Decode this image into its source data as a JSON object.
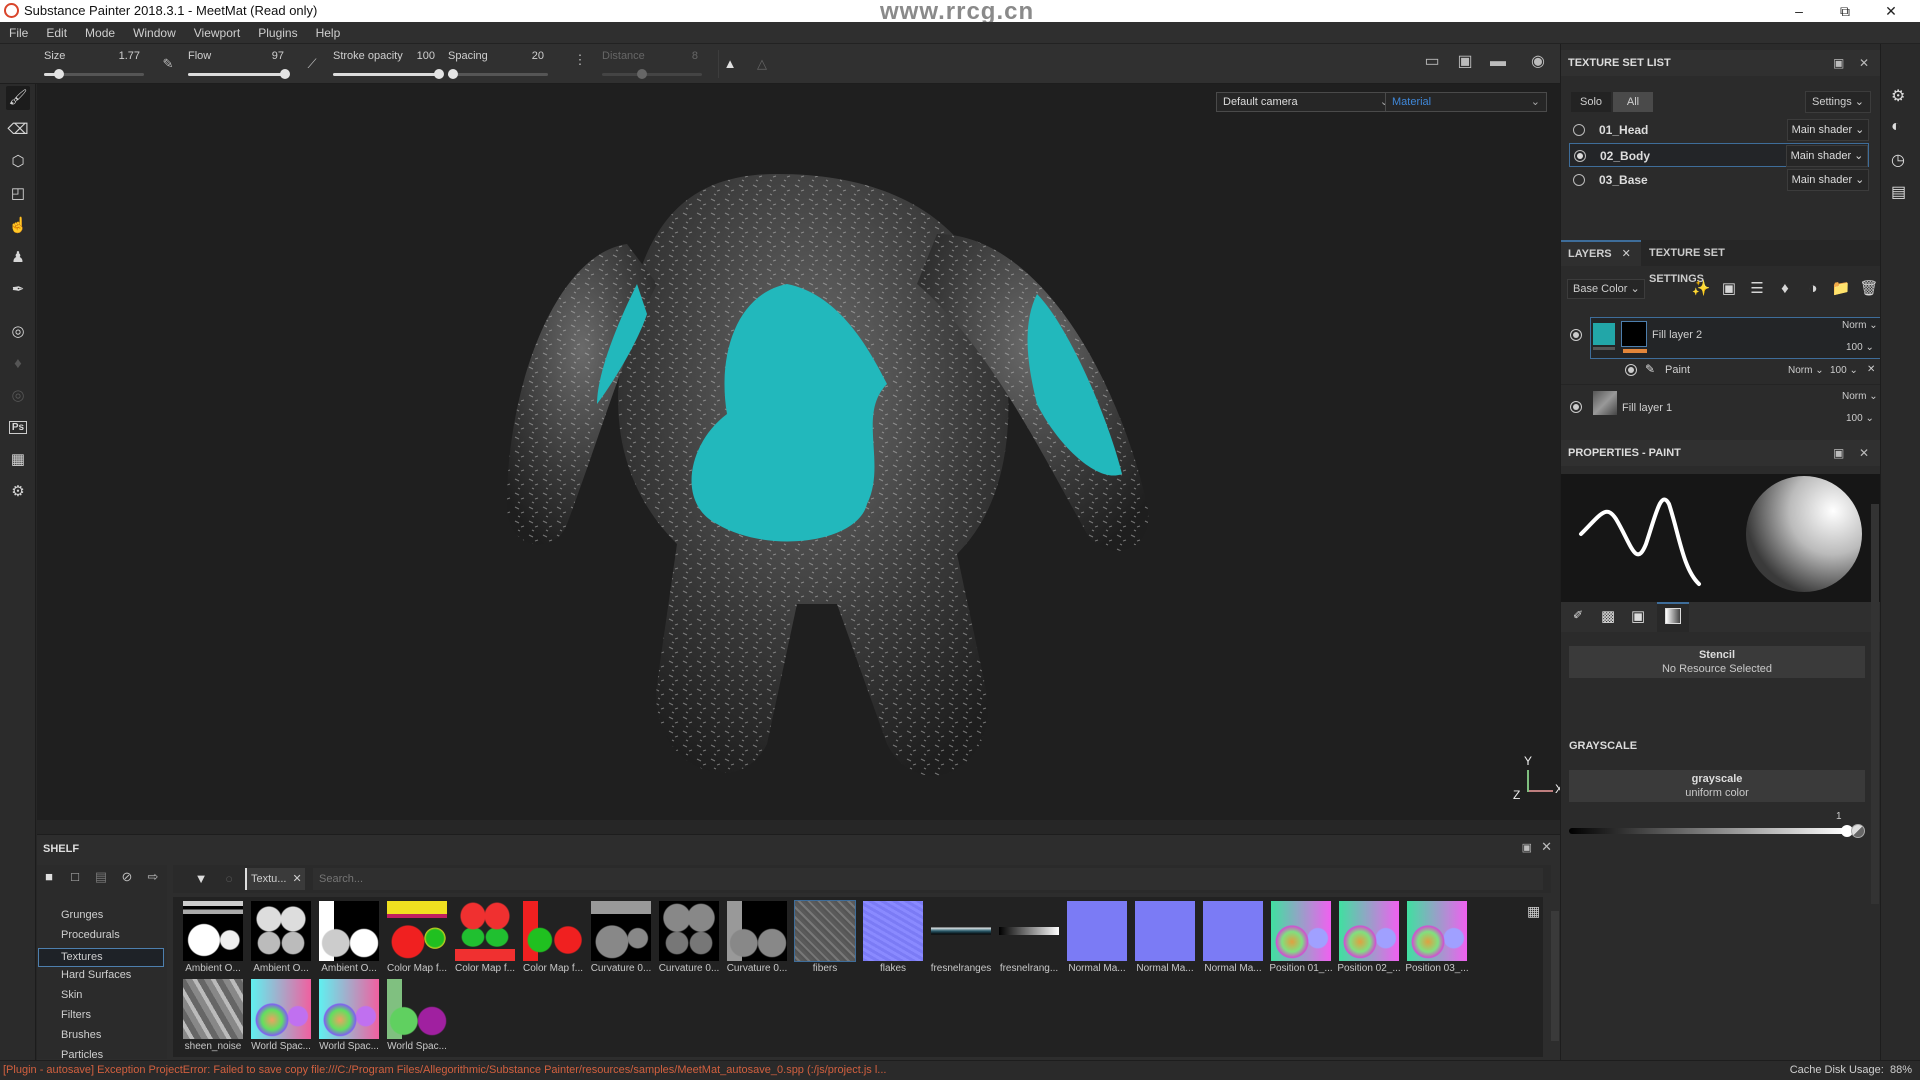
{
  "window": {
    "title": "Substance Painter 2018.3.1 - MeetMat (Read only)",
    "controls": [
      "minimize",
      "restore",
      "close"
    ]
  },
  "menu": [
    "File",
    "Edit",
    "Mode",
    "Window",
    "Viewport",
    "Plugins",
    "Help"
  ],
  "tool_options": {
    "size": {
      "label": "Size",
      "value": "1.77",
      "fraction": 0.15
    },
    "flow": {
      "label": "Flow",
      "value": "97",
      "fraction": 0.97
    },
    "stroke_opacity": {
      "label": "Stroke opacity",
      "value": "100",
      "fraction": 1.0
    },
    "spacing": {
      "label": "Spacing",
      "value": "20",
      "fraction": 0.05
    },
    "distance": {
      "label": "Distance",
      "value": "8",
      "fraction": 0.4,
      "disabled": true
    }
  },
  "viewport": {
    "camera_select": "Default camera",
    "mode_select": "Material",
    "axis_labels": {
      "x": "X",
      "y": "Y",
      "z": "Z"
    },
    "watermark_url": "www.rrcg.cn"
  },
  "left_toolbar": [
    "paint-brush",
    "eraser",
    "projection",
    "polygon-fill",
    "smudge",
    "clone-stamp",
    "color-picker",
    "substance-share",
    "notification-bell",
    "substance-source",
    "photoshop-export",
    "iray-render",
    "substance-plugin"
  ],
  "right_strip": [
    "display-settings",
    "shader-settings",
    "history",
    "log"
  ],
  "texture_set_list": {
    "title": "TEXTURE SET LIST",
    "solo_label": "Solo",
    "all_label": "All",
    "settings_label": "Settings",
    "items": [
      {
        "name": "01_Head",
        "shader": "Main shader",
        "selected": false
      },
      {
        "name": "02_Body",
        "shader": "Main shader",
        "selected": true
      },
      {
        "name": "03_Base",
        "shader": "Main shader",
        "selected": false
      }
    ]
  },
  "layers": {
    "tabs": [
      "LAYERS",
      "TEXTURE SET SETTINGS"
    ],
    "channel_select": "Base Color",
    "items": [
      {
        "name": "Fill layer 2",
        "blend": "Norm",
        "opacity": "100",
        "selected": true,
        "effects": [
          {
            "name": "Paint",
            "blend": "Norm",
            "opacity": "100"
          }
        ]
      },
      {
        "name": "Fill layer 1",
        "blend": "Norm",
        "opacity": "100",
        "selected": false
      }
    ]
  },
  "properties": {
    "title": "PROPERTIES - PAINT",
    "stencil": {
      "title": "Stencil",
      "subtitle": "No Resource Selected"
    },
    "grayscale_section": "GRAYSCALE",
    "grayscale": {
      "title": "grayscale",
      "subtitle": "uniform color"
    },
    "slider": {
      "value": "1",
      "fraction": 1.0
    }
  },
  "shelf": {
    "title": "SHELF",
    "filter_tag": "Textu...",
    "search_placeholder": "Search...",
    "categories": [
      "Grunges",
      "Procedurals",
      "Textures",
      "Hard Surfaces",
      "Skin",
      "Filters",
      "Brushes",
      "Particles"
    ],
    "selected_category": "Textures",
    "items": [
      {
        "label": "Ambient O...",
        "kind": "ao1"
      },
      {
        "label": "Ambient O...",
        "kind": "ao2"
      },
      {
        "label": "Ambient O...",
        "kind": "ao3"
      },
      {
        "label": "Color Map f...",
        "kind": "cm1"
      },
      {
        "label": "Color Map f...",
        "kind": "cm2"
      },
      {
        "label": "Color Map f...",
        "kind": "cm3"
      },
      {
        "label": "Curvature 0...",
        "kind": "cu1"
      },
      {
        "label": "Curvature 0...",
        "kind": "cu2"
      },
      {
        "label": "Curvature 0...",
        "kind": "cu3"
      },
      {
        "label": "fibers",
        "kind": "fibers",
        "selected": true
      },
      {
        "label": "flakes",
        "kind": "flakes"
      },
      {
        "label": "fresnelranges",
        "kind": "fr1"
      },
      {
        "label": "fresnelrang...",
        "kind": "fr2"
      },
      {
        "label": "Normal Ma...",
        "kind": "nm"
      },
      {
        "label": "Normal Ma...",
        "kind": "nm"
      },
      {
        "label": "Normal Ma...",
        "kind": "nm"
      },
      {
        "label": "Position 01_...",
        "kind": "pos"
      },
      {
        "label": "Position 02_...",
        "kind": "pos"
      },
      {
        "label": "Position 03_...",
        "kind": "pos"
      },
      {
        "label": "sheen_noise",
        "kind": "sheen"
      },
      {
        "label": "World Spac...",
        "kind": "ws"
      },
      {
        "label": "World Spac...",
        "kind": "ws"
      },
      {
        "label": "World Spac...",
        "kind": "ws3"
      }
    ]
  },
  "status": {
    "error": "[Plugin - autosave] Exception ProjectError: Failed to save copy file:///C:/Program Files/Allegorithmic/Substance Painter/resources/samples/MeetMat_autosave_0.spp (:/js/project.js l...",
    "cache_label": "Cache Disk Usage:",
    "cache_value": "88%"
  },
  "colors": {
    "accent_blue": "#3e6d9a",
    "paint_teal": "#22b8bc",
    "error_text": "#d2603f",
    "material_text": "#3f87d8"
  }
}
